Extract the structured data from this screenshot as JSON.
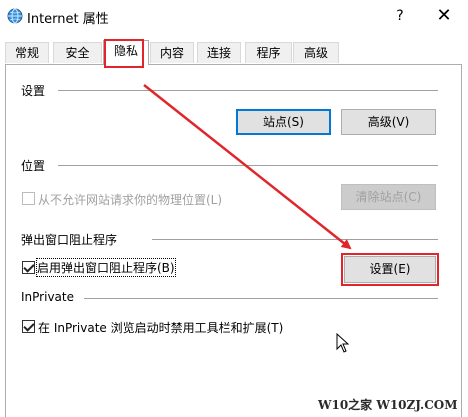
{
  "window": {
    "title": "Internet 属性",
    "help_label": "?",
    "close_label": "✕",
    "app_icon": "globe-icon"
  },
  "tabs": [
    {
      "label": "常规"
    },
    {
      "label": "安全"
    },
    {
      "label": "隐私",
      "active": true
    },
    {
      "label": "内容"
    },
    {
      "label": "连接"
    },
    {
      "label": "程序"
    },
    {
      "label": "高级"
    }
  ],
  "sections": {
    "settings": {
      "title": "设置",
      "sites_button": "站点(S)",
      "advanced_button": "高级(V)"
    },
    "location": {
      "title": "位置",
      "block_location_label": "从不允许网站请求你的物理位置(L)",
      "block_location_checked": false,
      "clear_sites_button": "清除站点(C)"
    },
    "popup_blocker": {
      "title": "弹出窗口阻止程序",
      "enable_label": "启用弹出窗口阻止程序(B)",
      "enable_checked": true,
      "settings_button": "设置(E)"
    },
    "inprivate": {
      "title": "InPrivate",
      "disable_toolbars_label": "在 InPrivate 浏览启动时禁用工具栏和扩展(T)",
      "disable_toolbars_checked": true
    }
  },
  "annotation": {
    "color": "#e0262b"
  },
  "watermark": {
    "text": "W10之家 W10ZJ.COM"
  }
}
